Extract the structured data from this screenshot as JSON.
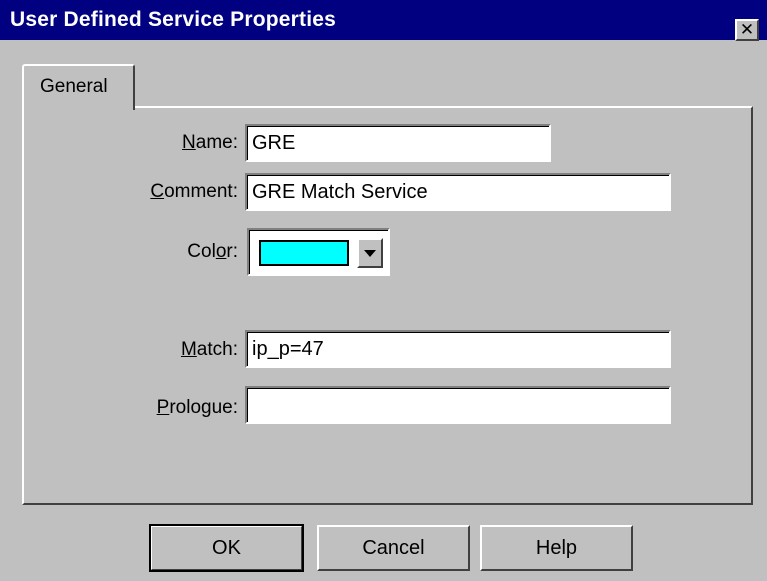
{
  "window": {
    "title": "User Defined Service Properties",
    "close_label": "✕"
  },
  "tabs": [
    {
      "label": "General",
      "selected": true
    }
  ],
  "fields": {
    "name": {
      "label_hotkey": "N",
      "label_rest": "ame:",
      "value": "GRE"
    },
    "comment": {
      "label_hotkey": "C",
      "label_rest": "omment:",
      "value": "GRE Match Service"
    },
    "color": {
      "label_before": "Col",
      "label_hotkey": "o",
      "label_rest": "r:",
      "value": "#00ffff"
    },
    "match": {
      "label_hotkey": "M",
      "label_rest": "atch:",
      "value": "ip_p=47"
    },
    "prologue": {
      "label_hotkey": "P",
      "label_rest": "rologue:",
      "value": ""
    }
  },
  "buttons": {
    "ok": "OK",
    "cancel": "Cancel",
    "help": "Help"
  },
  "icons": {
    "close": "close-icon",
    "dropdown": "chevron-down-icon"
  }
}
